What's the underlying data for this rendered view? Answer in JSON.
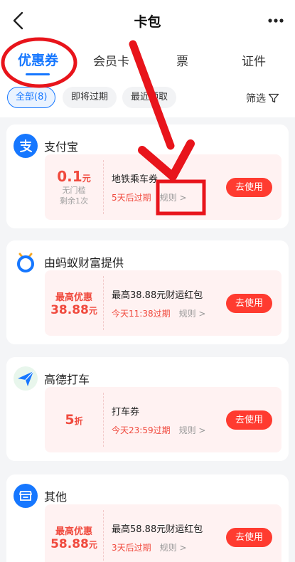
{
  "header": {
    "title": "卡包"
  },
  "tabs": [
    {
      "label": "优惠券",
      "active": true
    },
    {
      "label": "会员卡",
      "active": false
    },
    {
      "label": "票",
      "active": false
    },
    {
      "label": "证件",
      "active": false
    }
  ],
  "filters": {
    "chips": [
      {
        "label": "全部(8)",
        "active": true
      },
      {
        "label": "即将过期",
        "active": false
      },
      {
        "label": "最近领取",
        "active": false
      }
    ],
    "filter_label": "筛选"
  },
  "cards": [
    {
      "merchant": "支付宝",
      "logo_icon": "alipay-icon",
      "coupon": {
        "amount": "0.1",
        "unit": "元",
        "sub1": "无门槛",
        "sub2": "剩余1次",
        "name": "地铁乘车券",
        "expire": "5天后过期",
        "rules": "规则",
        "button": "去使用"
      }
    },
    {
      "merchant": "由蚂蚁财富提供",
      "logo_icon": "ant-fortune-icon",
      "coupon": {
        "prefix": "最高优惠",
        "amount": "38.88",
        "unit": "元",
        "name": "最高38.88元财运红包",
        "expire": "今天11:38过期",
        "rules": "规则",
        "button": "去使用"
      }
    },
    {
      "merchant": "高德打车",
      "logo_icon": "amap-taxi-icon",
      "coupon": {
        "amount": "5",
        "unit": "折",
        "name": "打车券",
        "expire": "今天23:59过期",
        "rules": "规则",
        "button": "去使用"
      }
    },
    {
      "merchant": "其他",
      "logo_icon": "store-icon",
      "coupon": {
        "prefix": "最高优惠",
        "amount": "58.88",
        "unit": "元",
        "name": "最高58.88元财运红包",
        "expire": "3天后过期",
        "rules": "规则",
        "button": "去使用"
      }
    }
  ],
  "colors": {
    "accent_blue": "#1677ff",
    "coupon_red": "#f04a3e",
    "button_red": "#ff3b30",
    "annotation_red": "#e8141b"
  }
}
